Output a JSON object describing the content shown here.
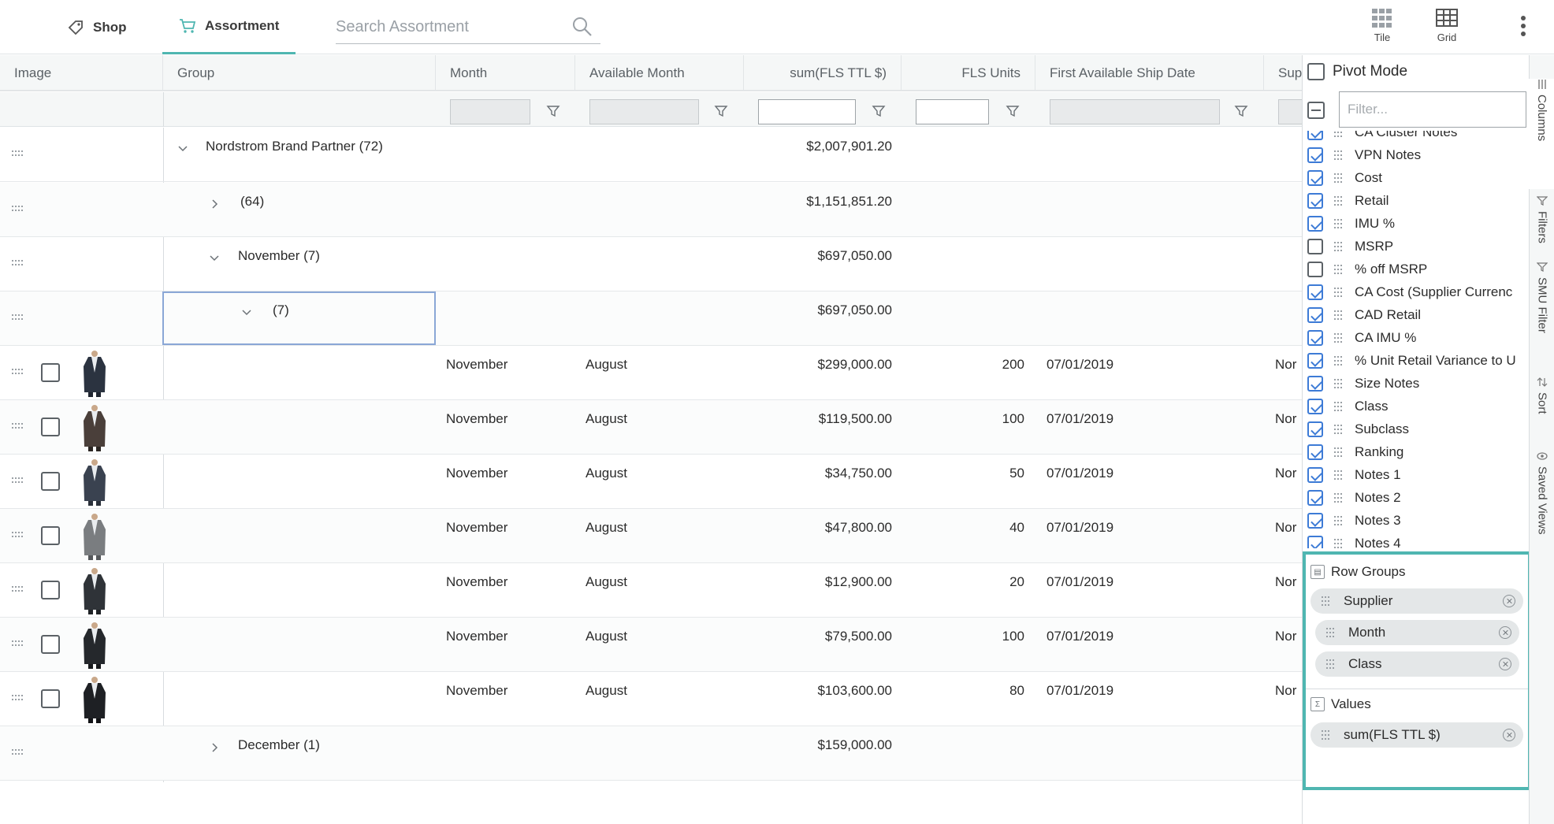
{
  "nav": {
    "shop_label": "Shop",
    "assortment_label": "Assortment",
    "search_placeholder": "Search Assortment"
  },
  "view_buttons": {
    "tile_label": "Tile",
    "grid_label": "Grid"
  },
  "grid": {
    "headers": {
      "image": "Image",
      "group": "Group",
      "month": "Month",
      "available_month": "Available Month",
      "sum_fls": "sum(FLS TTL $)",
      "fls_units": "FLS Units",
      "first_ship": "First Available Ship Date",
      "supplier": "Sup"
    },
    "group_rows": [
      {
        "label": "Nordstrom Brand Partner (72)",
        "sum": "$2,007,901.20",
        "expanded": true
      },
      {
        "label": "(64)",
        "sum": "$1,151,851.20",
        "expanded": false
      },
      {
        "label": "November (7)",
        "sum": "$697,050.00",
        "expanded": true
      },
      {
        "label": "(7)",
        "sum": "$697,050.00",
        "expanded": true
      }
    ],
    "item_rows": [
      {
        "month": "November",
        "available_month": "August",
        "sum": "$299,000.00",
        "units": "200",
        "ship_date": "07/01/2019",
        "supplier": "Nor"
      },
      {
        "month": "November",
        "available_month": "August",
        "sum": "$119,500.00",
        "units": "100",
        "ship_date": "07/01/2019",
        "supplier": "Nor"
      },
      {
        "month": "November",
        "available_month": "August",
        "sum": "$34,750.00",
        "units": "50",
        "ship_date": "07/01/2019",
        "supplier": "Nor"
      },
      {
        "month": "November",
        "available_month": "August",
        "sum": "$47,800.00",
        "units": "40",
        "ship_date": "07/01/2019",
        "supplier": "Nor"
      },
      {
        "month": "November",
        "available_month": "August",
        "sum": "$12,900.00",
        "units": "20",
        "ship_date": "07/01/2019",
        "supplier": "Nor"
      },
      {
        "month": "November",
        "available_month": "August",
        "sum": "$79,500.00",
        "units": "100",
        "ship_date": "07/01/2019",
        "supplier": "Nor"
      },
      {
        "month": "November",
        "available_month": "August",
        "sum": "$103,600.00",
        "units": "80",
        "ship_date": "07/01/2019",
        "supplier": "Nor"
      }
    ],
    "footer_group": {
      "label": "December (1)",
      "sum": "$159,000.00",
      "expanded": false
    }
  },
  "panel": {
    "pivot_mode_label": "Pivot Mode",
    "filter_placeholder": "Filter...",
    "columns": [
      {
        "label": "CA Cluster Notes",
        "checked": true
      },
      {
        "label": "VPN Notes",
        "checked": true
      },
      {
        "label": "Cost",
        "checked": true
      },
      {
        "label": "Retail",
        "checked": true
      },
      {
        "label": "IMU %",
        "checked": true
      },
      {
        "label": "MSRP",
        "checked": false
      },
      {
        "label": "% off MSRP",
        "checked": false
      },
      {
        "label": "CA Cost (Supplier Currenc",
        "checked": true
      },
      {
        "label": "CAD Retail",
        "checked": true
      },
      {
        "label": "CA IMU %",
        "checked": true
      },
      {
        "label": "% Unit Retail Variance to U",
        "checked": true
      },
      {
        "label": "Size Notes",
        "checked": true
      },
      {
        "label": "Class",
        "checked": true
      },
      {
        "label": "Subclass",
        "checked": true
      },
      {
        "label": "Ranking",
        "checked": true
      },
      {
        "label": "Notes 1",
        "checked": true
      },
      {
        "label": "Notes 2",
        "checked": true
      },
      {
        "label": "Notes 3",
        "checked": true
      },
      {
        "label": "Notes 4",
        "checked": true
      }
    ],
    "row_groups_title": "Row Groups",
    "row_groups": [
      "Supplier",
      "Month",
      "Class"
    ],
    "values_title": "Values",
    "values": [
      "sum(FLS TTL $)"
    ]
  },
  "side_tabs": [
    "Columns",
    "Filters",
    "SMU Filter",
    "Sort",
    "Saved Views"
  ],
  "colors": {
    "accent": "#4fb6b1",
    "checkbox_blue": "#3d7bd6",
    "selection": "#8aa7d6"
  }
}
